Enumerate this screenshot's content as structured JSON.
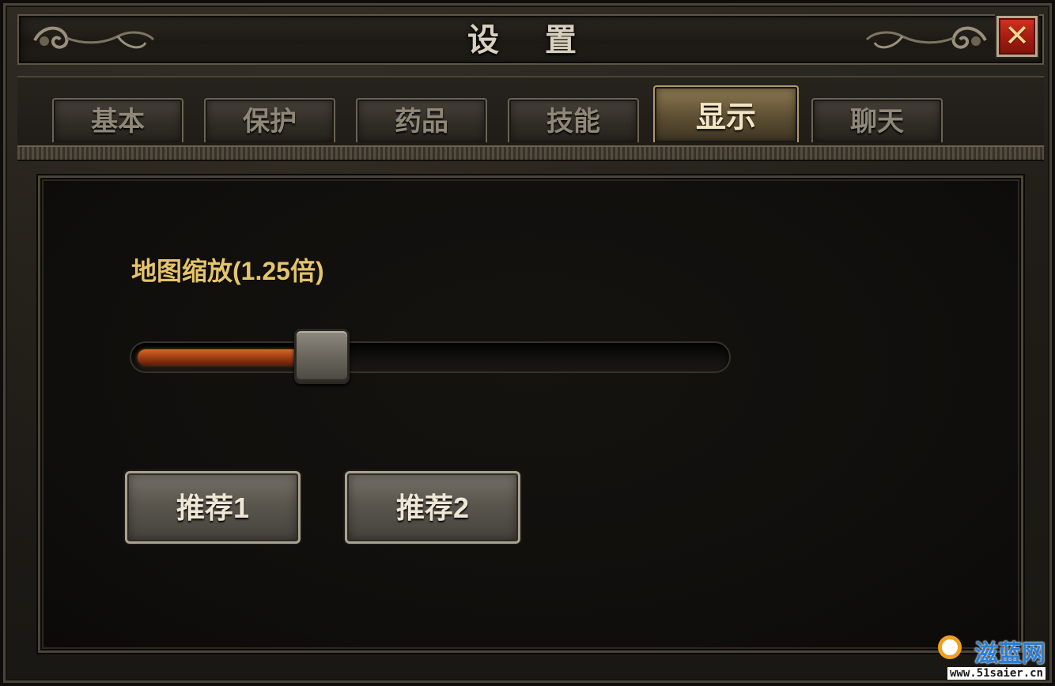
{
  "window": {
    "title": "设 置",
    "close_label": "✕"
  },
  "tabs": [
    {
      "label": "基本",
      "active": false
    },
    {
      "label": "保护",
      "active": false
    },
    {
      "label": "药品",
      "active": false
    },
    {
      "label": "技能",
      "active": false
    },
    {
      "label": "显示",
      "active": true
    },
    {
      "label": "聊天",
      "active": false
    }
  ],
  "display": {
    "zoom_label": "地图缩放(1.25倍)",
    "zoom_slider_fraction": 0.31,
    "buttons": {
      "preset1": "推荐1",
      "preset2": "推荐2"
    }
  },
  "watermark": {
    "logo_text": "滋蓝网",
    "url": "www.51saier.cn"
  },
  "colors": {
    "accent_gold": "#e5c46a",
    "close_red": "#c1291a",
    "slider_fill": "#c4541f",
    "active_tab": "#8e7a52"
  }
}
